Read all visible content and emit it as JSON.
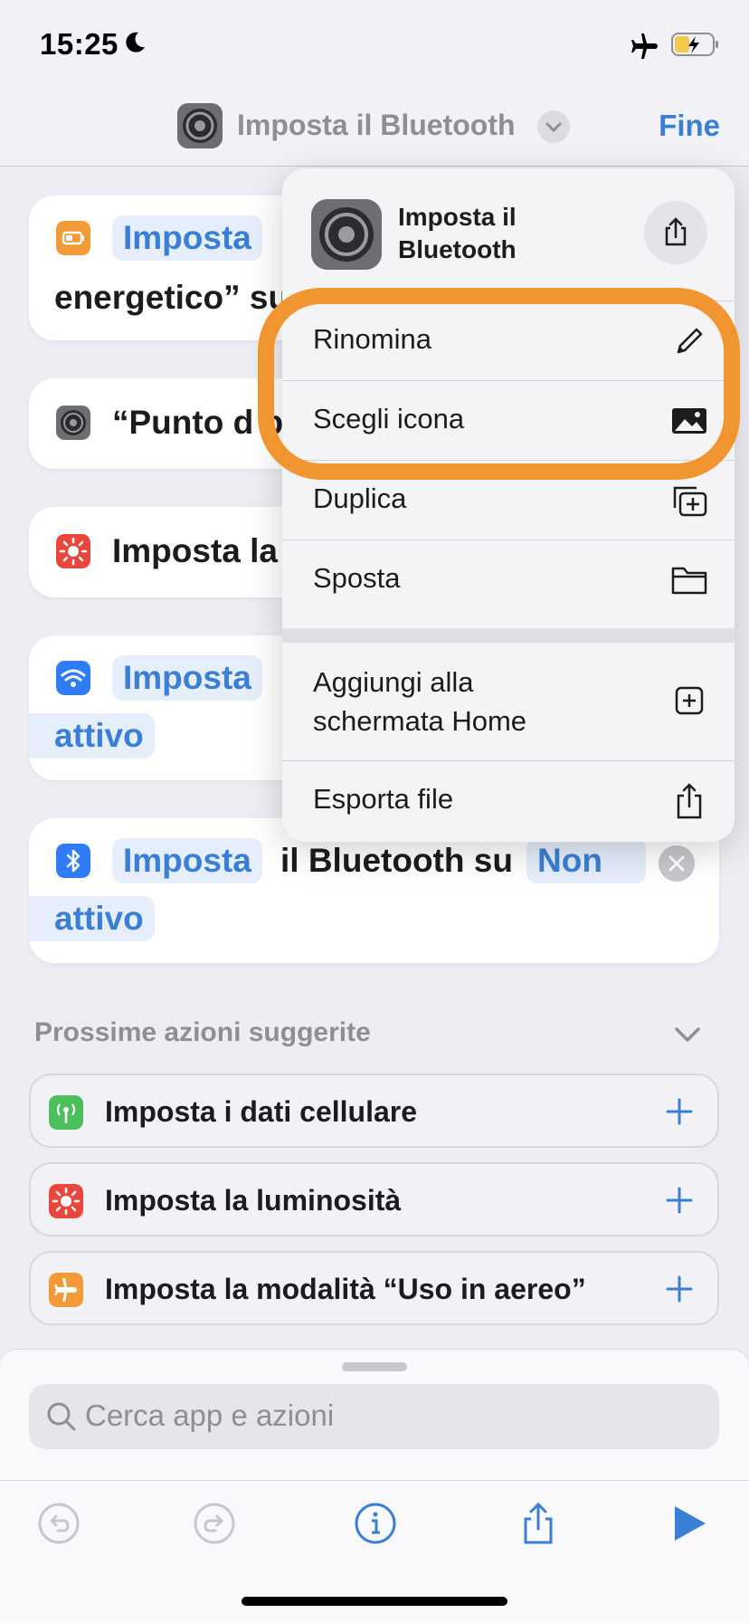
{
  "status_bar": {
    "time": "15:25"
  },
  "nav": {
    "title": "Imposta il Bluetooth",
    "done_label": "Fine"
  },
  "cards": [
    {
      "token1": "Imposta",
      "text2": "energetico” su"
    },
    {
      "text1": "“Punto d b"
    },
    {
      "text1": "Imposta la"
    },
    {
      "token1": "Imposta",
      "token2": "attivo"
    },
    {
      "token1": "Imposta",
      "text1": "il Bluetooth su",
      "token2": "Non",
      "token3": "attivo"
    }
  ],
  "menu": {
    "title": "Imposta il Bluetooth",
    "items": [
      {
        "label": "Rinomina",
        "icon": "pencil-icon"
      },
      {
        "label": "Scegli icona",
        "icon": "photo-icon"
      },
      {
        "label": "Duplica",
        "icon": "duplicate-icon"
      },
      {
        "label": "Sposta",
        "icon": "folder-icon"
      },
      {
        "label": "Aggiungi alla schermata Home",
        "label_line1": "Aggiungi alla",
        "label_line2": "schermata Home",
        "icon": "add-square-icon"
      },
      {
        "label": "Esporta file",
        "icon": "export-icon"
      }
    ]
  },
  "suggestions": {
    "header": "Prossime azioni suggerite",
    "items": [
      {
        "label": "Imposta i dati cellulare",
        "icon": "cellular-icon",
        "color": "#4cbf5c"
      },
      {
        "label": "Imposta la luminosità",
        "icon": "brightness-icon",
        "color": "#e9473d"
      },
      {
        "label": "Imposta la modalità “Uso in aereo”",
        "icon": "airplane-icon",
        "color": "#f19a37"
      }
    ]
  },
  "search": {
    "placeholder": "Cerca app e azioni"
  },
  "colors": {
    "accent": "#3a7fd6",
    "highlight": "#f0952f"
  }
}
